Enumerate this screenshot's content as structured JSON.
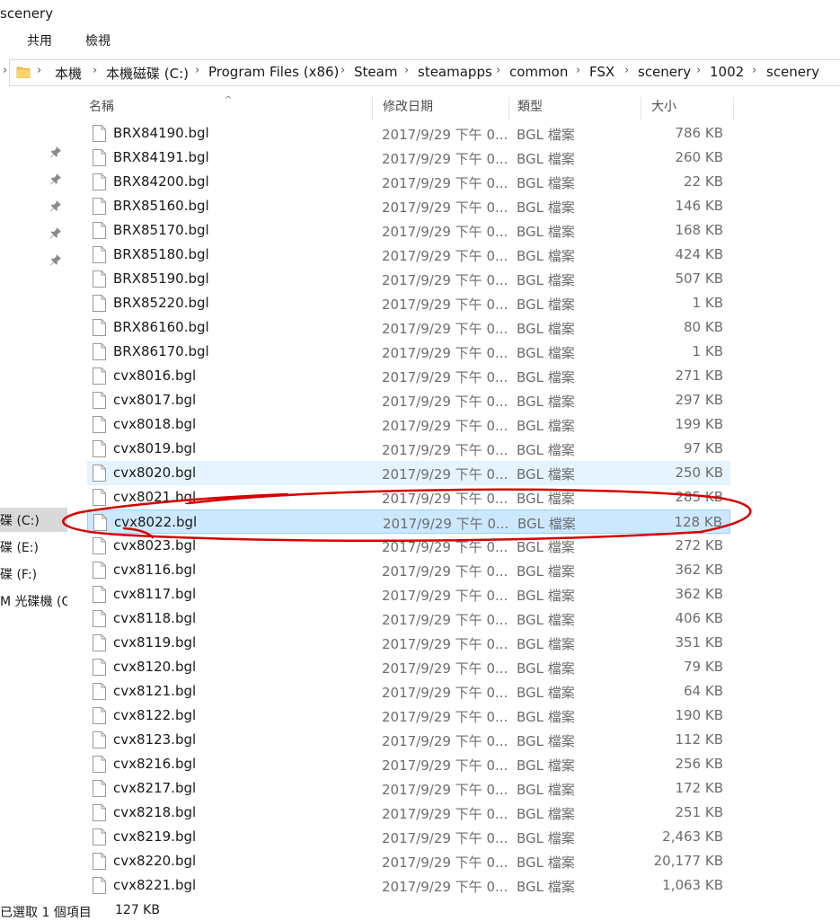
{
  "window": {
    "title": "scenery"
  },
  "ribbon": {
    "tabs": [
      "共用",
      "檢視"
    ]
  },
  "address": {
    "crumbs": [
      "本機",
      "本機磁碟 (C:)",
      "Program Files (x86)",
      "Steam",
      "steamapps",
      "common",
      "FSX",
      "scenery",
      "1002",
      "scenery"
    ]
  },
  "nav": {
    "drives": [
      {
        "label": "碟 (C:)",
        "selected": true
      },
      {
        "label": "碟 (E:)",
        "selected": false
      },
      {
        "label": "碟 (F:)",
        "selected": false
      },
      {
        "label": "M 光碟機 (G",
        "selected": false
      }
    ]
  },
  "columns": {
    "name": "名稱",
    "date": "修改日期",
    "type": "類型",
    "size": "大小"
  },
  "files": [
    {
      "name": "BRX84190.bgl",
      "date": "2017/9/29 下午 0...",
      "type": "BGL 檔案",
      "size": "786 KB"
    },
    {
      "name": "BRX84191.bgl",
      "date": "2017/9/29 下午 0...",
      "type": "BGL 檔案",
      "size": "260 KB"
    },
    {
      "name": "BRX84200.bgl",
      "date": "2017/9/29 下午 0...",
      "type": "BGL 檔案",
      "size": "22 KB"
    },
    {
      "name": "BRX85160.bgl",
      "date": "2017/9/29 下午 0...",
      "type": "BGL 檔案",
      "size": "146 KB"
    },
    {
      "name": "BRX85170.bgl",
      "date": "2017/9/29 下午 0...",
      "type": "BGL 檔案",
      "size": "168 KB"
    },
    {
      "name": "BRX85180.bgl",
      "date": "2017/9/29 下午 0...",
      "type": "BGL 檔案",
      "size": "424 KB"
    },
    {
      "name": "BRX85190.bgl",
      "date": "2017/9/29 下午 0...",
      "type": "BGL 檔案",
      "size": "507 KB"
    },
    {
      "name": "BRX85220.bgl",
      "date": "2017/9/29 下午 0...",
      "type": "BGL 檔案",
      "size": "1 KB"
    },
    {
      "name": "BRX86160.bgl",
      "date": "2017/9/29 下午 0...",
      "type": "BGL 檔案",
      "size": "80 KB"
    },
    {
      "name": "BRX86170.bgl",
      "date": "2017/9/29 下午 0...",
      "type": "BGL 檔案",
      "size": "1 KB"
    },
    {
      "name": "cvx8016.bgl",
      "date": "2017/9/29 下午 0...",
      "type": "BGL 檔案",
      "size": "271 KB"
    },
    {
      "name": "cvx8017.bgl",
      "date": "2017/9/29 下午 0...",
      "type": "BGL 檔案",
      "size": "297 KB"
    },
    {
      "name": "cvx8018.bgl",
      "date": "2017/9/29 下午 0...",
      "type": "BGL 檔案",
      "size": "199 KB"
    },
    {
      "name": "cvx8019.bgl",
      "date": "2017/9/29 下午 0...",
      "type": "BGL 檔案",
      "size": "97 KB"
    },
    {
      "name": "cvx8020.bgl",
      "date": "2017/9/29 下午 0...",
      "type": "BGL 檔案",
      "size": "250 KB",
      "state": "hover"
    },
    {
      "name": "cvx8021.bgl",
      "date": "2017/9/29 下午 0...",
      "type": "BGL 檔案",
      "size": "285 KB"
    },
    {
      "name": "cvx8022.bgl",
      "date": "2017/9/29 下午 0...",
      "type": "BGL 檔案",
      "size": "128 KB",
      "state": "selected"
    },
    {
      "name": "cvx8023.bgl",
      "date": "2017/9/29 下午 0...",
      "type": "BGL 檔案",
      "size": "272 KB"
    },
    {
      "name": "cvx8116.bgl",
      "date": "2017/9/29 下午 0...",
      "type": "BGL 檔案",
      "size": "362 KB"
    },
    {
      "name": "cvx8117.bgl",
      "date": "2017/9/29 下午 0...",
      "type": "BGL 檔案",
      "size": "362 KB"
    },
    {
      "name": "cvx8118.bgl",
      "date": "2017/9/29 下午 0...",
      "type": "BGL 檔案",
      "size": "406 KB"
    },
    {
      "name": "cvx8119.bgl",
      "date": "2017/9/29 下午 0...",
      "type": "BGL 檔案",
      "size": "351 KB"
    },
    {
      "name": "cvx8120.bgl",
      "date": "2017/9/29 下午 0...",
      "type": "BGL 檔案",
      "size": "79 KB"
    },
    {
      "name": "cvx8121.bgl",
      "date": "2017/9/29 下午 0...",
      "type": "BGL 檔案",
      "size": "64 KB"
    },
    {
      "name": "cvx8122.bgl",
      "date": "2017/9/29 下午 0...",
      "type": "BGL 檔案",
      "size": "190 KB"
    },
    {
      "name": "cvx8123.bgl",
      "date": "2017/9/29 下午 0...",
      "type": "BGL 檔案",
      "size": "112 KB"
    },
    {
      "name": "cvx8216.bgl",
      "date": "2017/9/29 下午 0...",
      "type": "BGL 檔案",
      "size": "256 KB"
    },
    {
      "name": "cvx8217.bgl",
      "date": "2017/9/29 下午 0...",
      "type": "BGL 檔案",
      "size": "172 KB"
    },
    {
      "name": "cvx8218.bgl",
      "date": "2017/9/29 下午 0...",
      "type": "BGL 檔案",
      "size": "251 KB"
    },
    {
      "name": "cvx8219.bgl",
      "date": "2017/9/29 下午 0...",
      "type": "BGL 檔案",
      "size": "2,463 KB"
    },
    {
      "name": "cvx8220.bgl",
      "date": "2017/9/29 下午 0...",
      "type": "BGL 檔案",
      "size": "20,177 KB"
    },
    {
      "name": "cvx8221.bgl",
      "date": "2017/9/29 下午 0...",
      "type": "BGL 檔案",
      "size": "1,063 KB"
    }
  ],
  "status": {
    "selection": "已選取 1 個項目",
    "size": "127 KB"
  },
  "colors": {
    "selected_bg": "#cce8ff",
    "hover_bg": "#e5f3ff",
    "annotation": "#d40000",
    "folder": "#f5c542"
  },
  "icons": {
    "folder": "folder-icon",
    "file": "file-icon",
    "pin": "pin-icon",
    "chevron": "chevron-right-icon"
  }
}
